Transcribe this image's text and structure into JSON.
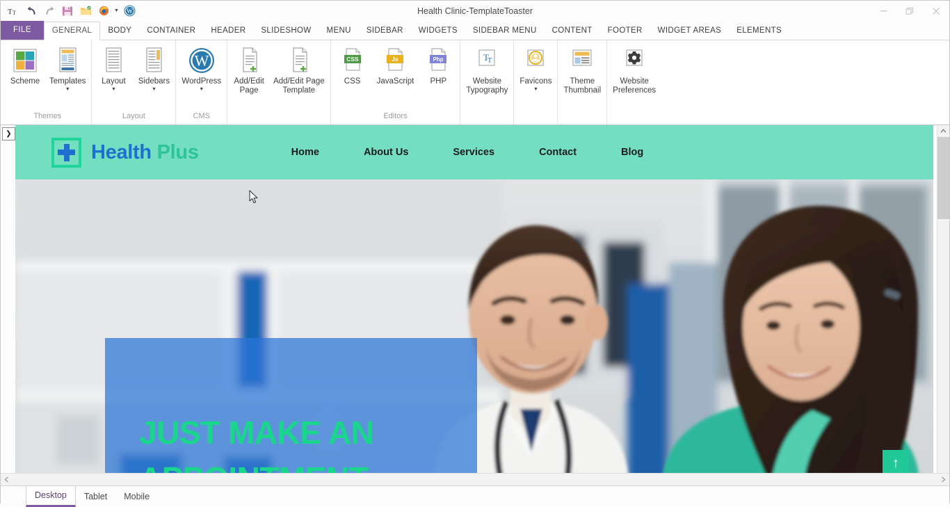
{
  "window": {
    "title": "Health Clinic-TemplateToaster",
    "minimize": "—",
    "restore": "❐",
    "close": "✕"
  },
  "quick_access": {
    "items": [
      {
        "name": "text-tool-icon",
        "glyph": "T"
      },
      {
        "name": "undo-icon",
        "glyph": "↶"
      },
      {
        "name": "redo-icon",
        "glyph": "↷"
      },
      {
        "name": "save-icon",
        "glyph": "Ὃe"
      },
      {
        "name": "open-folder-icon",
        "glyph": "Ὄ1"
      },
      {
        "name": "firefox-preview-icon",
        "glyph": "●"
      },
      {
        "name": "wordpress-export-icon",
        "glyph": "W"
      }
    ]
  },
  "ribbon_tabs": [
    {
      "label": "FILE",
      "active": false,
      "file": true
    },
    {
      "label": "GENERAL",
      "active": true
    },
    {
      "label": "BODY",
      "active": false
    },
    {
      "label": "CONTAINER",
      "active": false
    },
    {
      "label": "HEADER",
      "active": false
    },
    {
      "label": "SLIDESHOW",
      "active": false
    },
    {
      "label": "MENU",
      "active": false
    },
    {
      "label": "SIDEBAR",
      "active": false
    },
    {
      "label": "WIDGETS",
      "active": false
    },
    {
      "label": "SIDEBAR MENU",
      "active": false
    },
    {
      "label": "CONTENT",
      "active": false
    },
    {
      "label": "FOOTER",
      "active": false
    },
    {
      "label": "WIDGET AREAS",
      "active": false
    },
    {
      "label": "ELEMENTS",
      "active": false
    }
  ],
  "ribbon_groups": [
    {
      "label": "Themes",
      "items": [
        {
          "name": "scheme-button",
          "label": "Scheme",
          "icon": "color-swatches-icon",
          "caret": false
        },
        {
          "name": "templates-button",
          "label": "Templates",
          "icon": "template-page-icon",
          "caret": true
        }
      ]
    },
    {
      "label": "Layout",
      "items": [
        {
          "name": "layout-button",
          "label": "Layout",
          "icon": "layout-lines-icon",
          "caret": true
        },
        {
          "name": "sidebars-button",
          "label": "Sidebars",
          "icon": "sidebar-column-icon",
          "caret": true
        }
      ]
    },
    {
      "label": "CMS",
      "items": [
        {
          "name": "wordpress-button",
          "label": "WordPress",
          "icon": "wordpress-icon",
          "caret": true
        }
      ]
    },
    {
      "label": "",
      "items": [
        {
          "name": "add-edit-page-button",
          "label": "Add/Edit\nPage",
          "icon": "page-plus-icon",
          "caret": false
        },
        {
          "name": "add-edit-page-template-button",
          "label": "Add/Edit Page\nTemplate",
          "icon": "page-plus-icon",
          "caret": false
        }
      ]
    },
    {
      "label": "Editors",
      "items": [
        {
          "name": "css-editor-button",
          "label": "CSS",
          "icon": "css-file-icon",
          "caret": false
        },
        {
          "name": "javascript-editor-button",
          "label": "JavaScript",
          "icon": "js-file-icon",
          "caret": false
        },
        {
          "name": "php-editor-button",
          "label": "PHP",
          "icon": "php-file-icon",
          "caret": false
        }
      ]
    },
    {
      "label": "",
      "items": [
        {
          "name": "website-typography-button",
          "label": "Website\nTypography",
          "icon": "typography-icon",
          "caret": false
        }
      ]
    },
    {
      "label": "",
      "items": [
        {
          "name": "favicons-button",
          "label": "Favicons",
          "icon": "favicon-badge-icon",
          "caret": true
        }
      ]
    },
    {
      "label": "",
      "items": [
        {
          "name": "theme-thumbnail-button",
          "label": "Theme\nThumbnail",
          "icon": "thumbnail-icon",
          "caret": false
        }
      ]
    },
    {
      "label": "",
      "items": [
        {
          "name": "website-preferences-button",
          "label": "Website\nPreferences",
          "icon": "gear-icon",
          "caret": false
        }
      ]
    }
  ],
  "preview": {
    "logo": {
      "primary": "Health",
      "secondary": "Plus",
      "mark": "medical-cross-icon"
    },
    "nav": [
      {
        "label": "Home"
      },
      {
        "label": "About Us"
      },
      {
        "label": "Services"
      },
      {
        "label": "Contact"
      },
      {
        "label": "Blog"
      }
    ],
    "hero": {
      "title": "JUST MAKE AN APPOINTMENT",
      "scroll_top": "↑"
    }
  },
  "device_tabs": [
    {
      "label": "Desktop",
      "active": true
    },
    {
      "label": "Tablet",
      "active": false
    },
    {
      "label": "Mobile",
      "active": false
    }
  ],
  "colors": {
    "file_tab_purple": "#7e5ba0",
    "site_header_teal": "#73dfc0",
    "hero_green": "#19d68c",
    "hero_panel_blue": "#2a74d6",
    "logo_blue": "#1f6fd0",
    "accent_teal": "#20c997"
  },
  "expand_panel": {
    "glyph": "❯"
  },
  "help": {
    "glyph": "?"
  }
}
